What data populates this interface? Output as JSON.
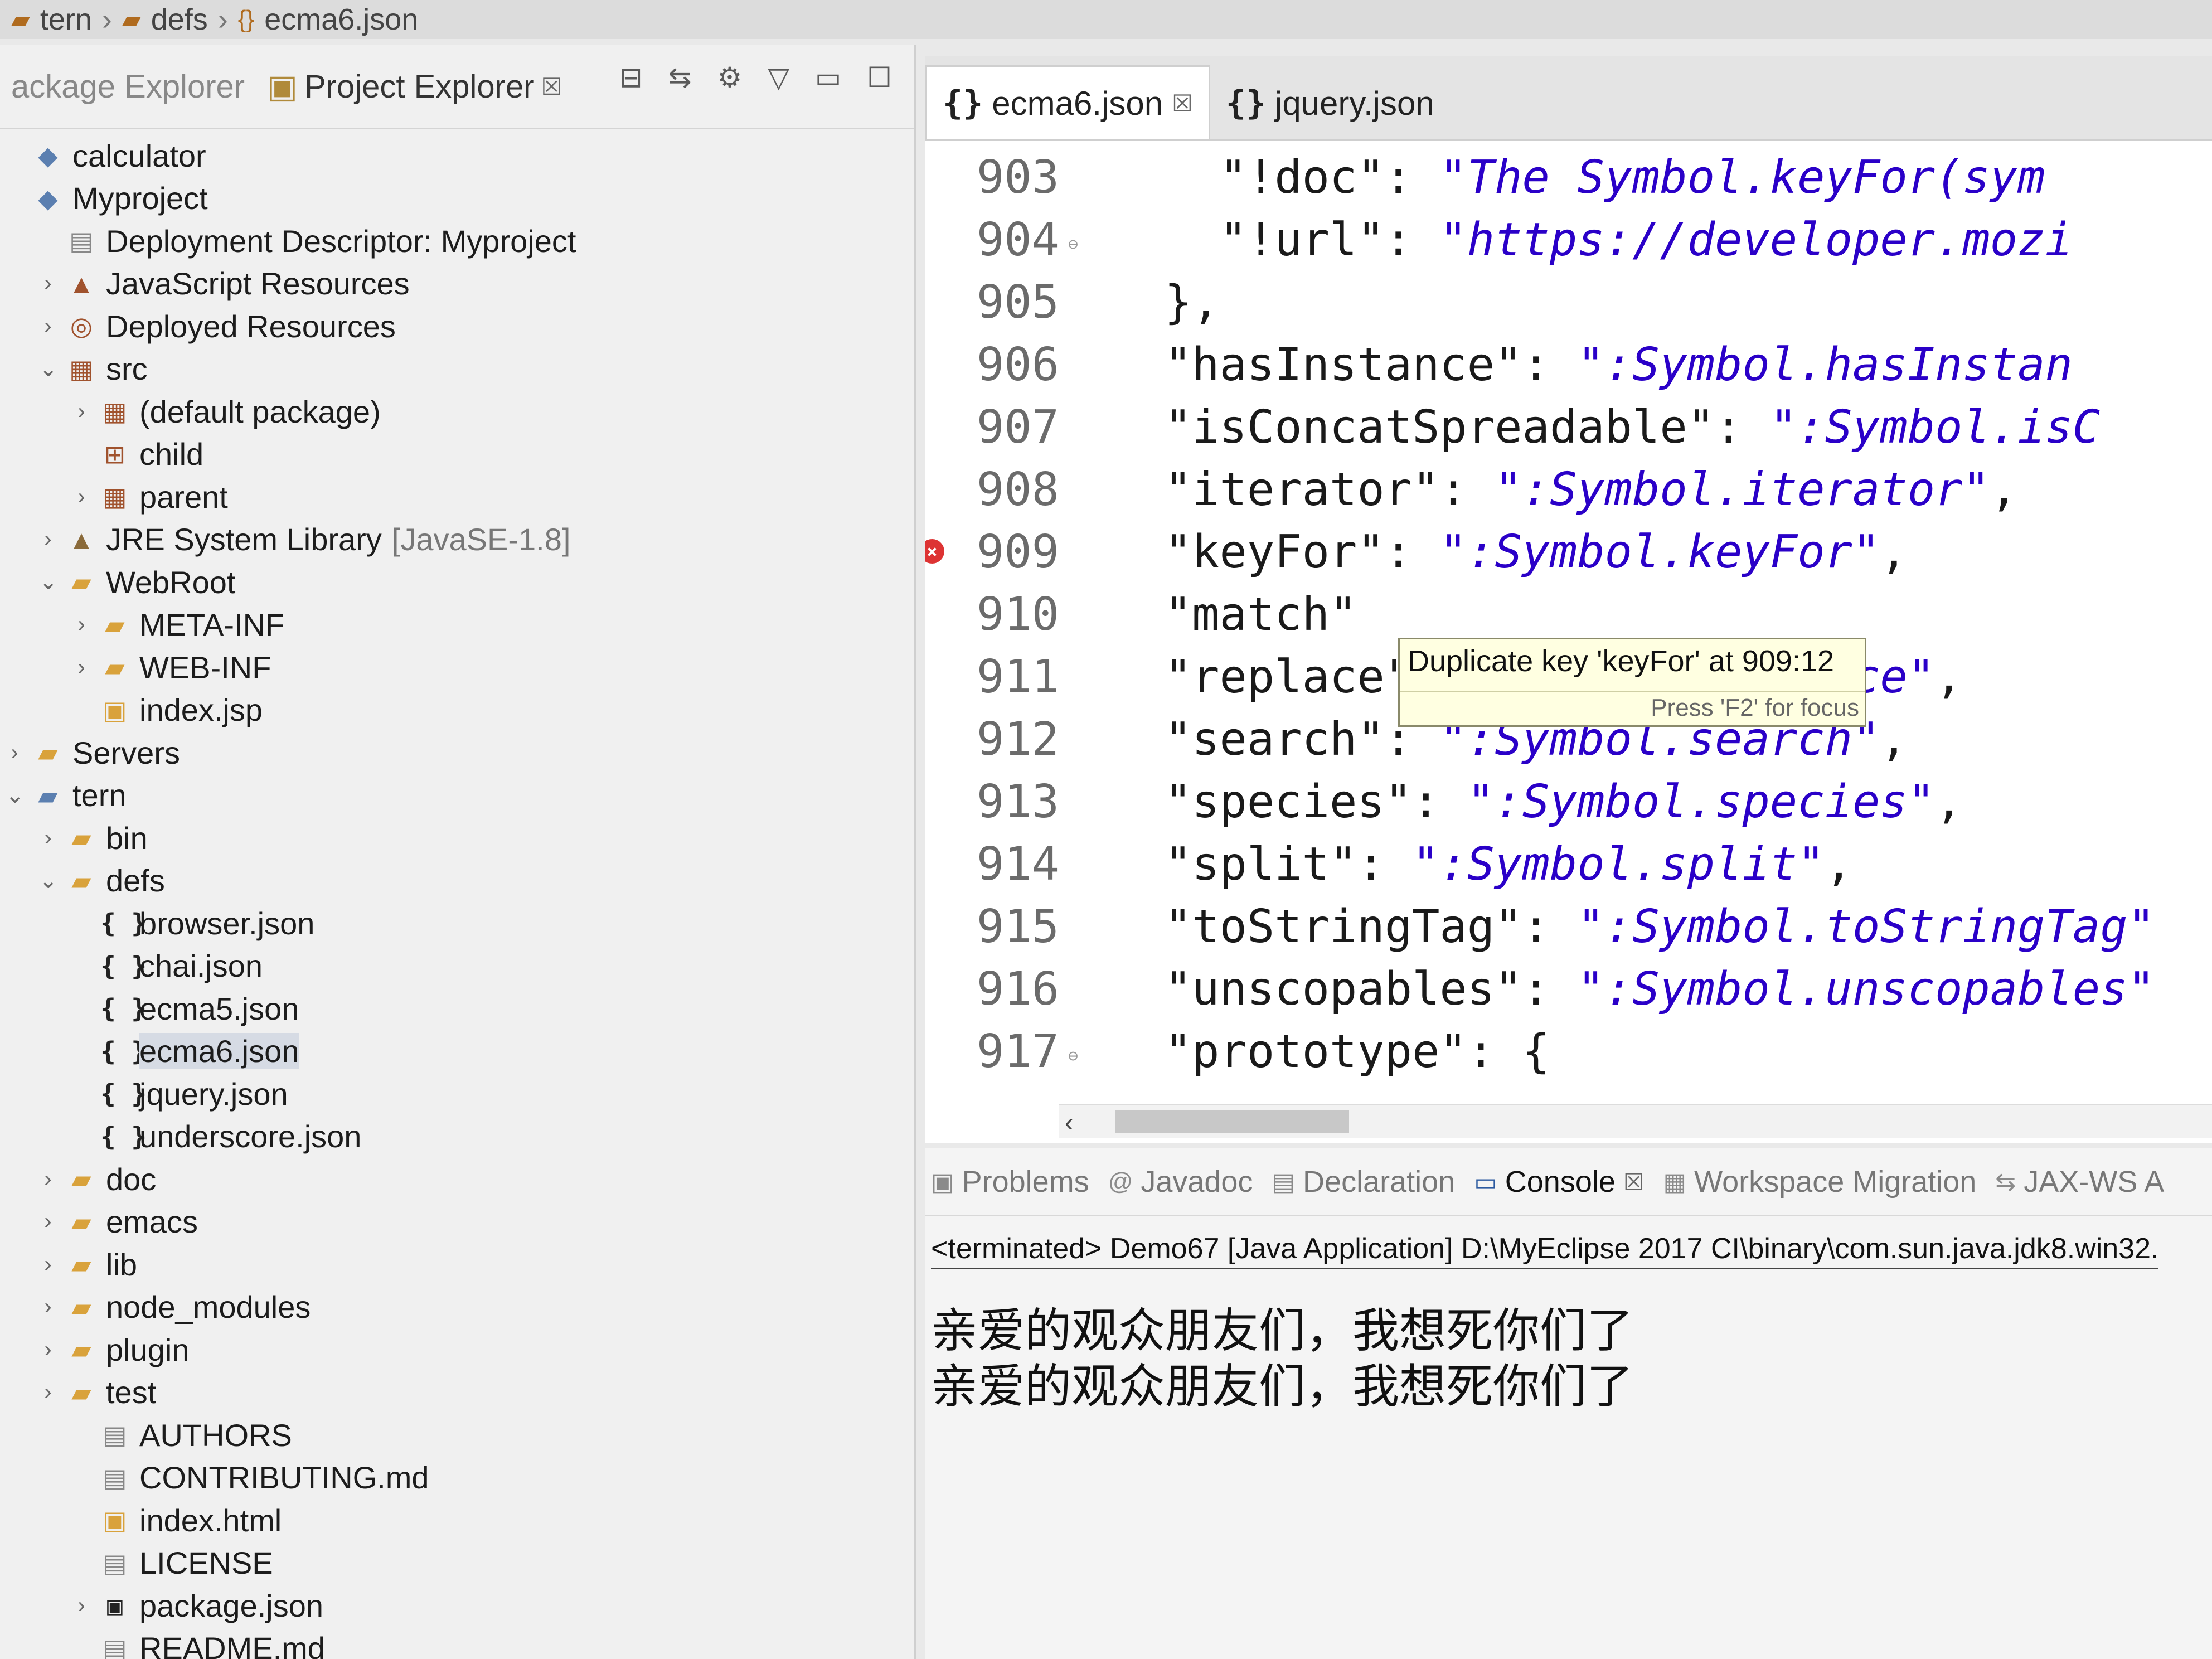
{
  "breadcrumb": {
    "items": [
      "tern",
      "defs",
      "ecma6.json"
    ],
    "separator": "›"
  },
  "left_panel": {
    "tabs": [
      {
        "label": "ackage Explorer"
      },
      {
        "label": "Project Explorer",
        "close": "☒"
      }
    ],
    "tree": [
      {
        "label": "calculator",
        "icon": "project-icon",
        "glyph": "◆",
        "level": 0,
        "chevron": ""
      },
      {
        "label": "Myproject",
        "icon": "project-icon",
        "glyph": "◆",
        "level": 0,
        "chevron": ""
      },
      {
        "label": "Deployment Descriptor: Myproject",
        "icon": "descriptor-icon",
        "glyph": "▤",
        "level": 1,
        "chevron": ""
      },
      {
        "label": "JavaScript Resources",
        "icon": "js-resources-icon",
        "glyph": "▲",
        "level": 1,
        "chevron": "›"
      },
      {
        "label": "Deployed Resources",
        "icon": "deployed-resources-icon",
        "glyph": "◎",
        "level": 1,
        "chevron": "›"
      },
      {
        "label": "src",
        "icon": "source-folder-icon",
        "glyph": "▦",
        "level": 1,
        "chevron": "⌄"
      },
      {
        "label": "(default package)",
        "icon": "package-icon",
        "glyph": "▦",
        "level": 2,
        "chevron": "›"
      },
      {
        "label": "child",
        "icon": "package-icon",
        "glyph": "⊞",
        "level": 2,
        "chevron": ""
      },
      {
        "label": "parent",
        "icon": "package-icon",
        "glyph": "▦",
        "level": 2,
        "chevron": "›"
      },
      {
        "label": "JRE System Library",
        "suffix": "[JavaSE-1.8]",
        "icon": "library-icon",
        "glyph": "▲",
        "level": 1,
        "chevron": "›"
      },
      {
        "label": "WebRoot",
        "icon": "folder-icon",
        "glyph": "▰",
        "level": 1,
        "chevron": "⌄"
      },
      {
        "label": "META-INF",
        "icon": "folder-icon",
        "glyph": "▰",
        "level": 2,
        "chevron": "›"
      },
      {
        "label": "WEB-INF",
        "icon": "folder-icon",
        "glyph": "▰",
        "level": 2,
        "chevron": "›"
      },
      {
        "label": "index.jsp",
        "icon": "jsp-file-icon",
        "glyph": "▣",
        "level": 2,
        "chevron": ""
      },
      {
        "label": "Servers",
        "icon": "folder-icon",
        "glyph": "▰",
        "level": 0,
        "chevron": "›"
      },
      {
        "label": "tern",
        "icon": "project-folder-icon",
        "glyph": "▰",
        "level": 0,
        "chevron": "⌄"
      },
      {
        "label": "bin",
        "icon": "folder-icon",
        "glyph": "▰",
        "level": 1,
        "chevron": "›"
      },
      {
        "label": "defs",
        "icon": "folder-icon",
        "glyph": "▰",
        "level": 1,
        "chevron": "⌄"
      },
      {
        "label": "browser.json",
        "icon": "json-file-icon",
        "glyph": "{ }",
        "level": 2,
        "chevron": ""
      },
      {
        "label": "chai.json",
        "icon": "json-file-icon",
        "glyph": "{ }",
        "level": 2,
        "chevron": ""
      },
      {
        "label": "ecma5.json",
        "icon": "json-file-icon",
        "glyph": "{ }",
        "level": 2,
        "chevron": ""
      },
      {
        "label": "ecma6.json",
        "icon": "json-file-icon",
        "glyph": "{ }",
        "level": 2,
        "chevron": "",
        "selected": true
      },
      {
        "label": "jquery.json",
        "icon": "json-file-icon",
        "glyph": "{ }",
        "level": 2,
        "chevron": ""
      },
      {
        "label": "underscore.json",
        "icon": "json-file-icon",
        "glyph": "{ }",
        "level": 2,
        "chevron": ""
      },
      {
        "label": "doc",
        "icon": "folder-icon",
        "glyph": "▰",
        "level": 1,
        "chevron": "›"
      },
      {
        "label": "emacs",
        "icon": "folder-icon",
        "glyph": "▰",
        "level": 1,
        "chevron": "›"
      },
      {
        "label": "lib",
        "icon": "folder-icon",
        "glyph": "▰",
        "level": 1,
        "chevron": "›"
      },
      {
        "label": "node_modules",
        "icon": "folder-icon",
        "glyph": "▰",
        "level": 1,
        "chevron": "›"
      },
      {
        "label": "plugin",
        "icon": "folder-icon",
        "glyph": "▰",
        "level": 1,
        "chevron": "›"
      },
      {
        "label": "test",
        "icon": "folder-icon",
        "glyph": "▰",
        "level": 1,
        "chevron": "›"
      },
      {
        "label": "AUTHORS",
        "icon": "text-file-icon",
        "glyph": "▤",
        "level": 2,
        "chevron": ""
      },
      {
        "label": "CONTRIBUTING.md",
        "icon": "text-file-icon",
        "glyph": "▤",
        "level": 2,
        "chevron": ""
      },
      {
        "label": "index.html",
        "icon": "html-file-icon",
        "glyph": "▣",
        "level": 2,
        "chevron": ""
      },
      {
        "label": "LICENSE",
        "icon": "text-file-icon",
        "glyph": "▤",
        "level": 2,
        "chevron": ""
      },
      {
        "label": "package.json",
        "icon": "json-file-icon",
        "glyph": "▣",
        "level": 2,
        "chevron": "›"
      },
      {
        "label": "README.md",
        "icon": "text-file-icon",
        "glyph": "▤",
        "level": 2,
        "chevron": ""
      }
    ]
  },
  "editor": {
    "tabs": [
      {
        "label": "ecma6.json",
        "close": "☒",
        "active": true
      },
      {
        "label": "jquery.json",
        "active": false
      }
    ],
    "lines": [
      {
        "num": "903",
        "indent": "    ",
        "key": "\"!doc\": ",
        "value": "\"The Symbol.keyFor(sym",
        "tail": ""
      },
      {
        "num": "904",
        "fold": true,
        "indent": "    ",
        "key": "\"!url\": ",
        "value": "\"https://developer.mozi",
        "tail": ""
      },
      {
        "num": "905",
        "indent": "  ",
        "key": "},",
        "value": "",
        "tail": ""
      },
      {
        "num": "906",
        "indent": "  ",
        "key": "\"hasInstance\": ",
        "value": "\":Symbol.hasInstan",
        "tail": ""
      },
      {
        "num": "907",
        "indent": "  ",
        "key": "\"isConcatSpreadable\": ",
        "value": "\":Symbol.isC",
        "tail": ""
      },
      {
        "num": "908",
        "indent": "  ",
        "key": "\"iterator\": ",
        "value": "\":Symbol.iterator\"",
        "tail": ","
      },
      {
        "num": "909",
        "error": true,
        "indent": "  ",
        "key": "\"keyFor\": ",
        "value": "\":Symbol.keyFor\"",
        "tail": ","
      },
      {
        "num": "910",
        "indent": "  ",
        "key": "\"match\"",
        "value": "",
        "tail": ""
      },
      {
        "num": "911",
        "indent": "  ",
        "key": "\"replace\": ",
        "value": "\":Symbol.replace\"",
        "tail": ","
      },
      {
        "num": "912",
        "indent": "  ",
        "key": "\"search\": ",
        "value": "\":Symbol.search\"",
        "tail": ","
      },
      {
        "num": "913",
        "indent": "  ",
        "key": "\"species\": ",
        "value": "\":Symbol.species\"",
        "tail": ","
      },
      {
        "num": "914",
        "indent": "  ",
        "key": "\"split\": ",
        "value": "\":Symbol.split\"",
        "tail": ","
      },
      {
        "num": "915",
        "indent": "  ",
        "key": "\"toStringTag\": ",
        "value": "\":Symbol.toStringTag\"",
        "tail": ""
      },
      {
        "num": "916",
        "indent": "  ",
        "key": "\"unscopables\": ",
        "value": "\":Symbol.unscopables\"",
        "tail": ""
      },
      {
        "num": "917",
        "fold": true,
        "indent": "  ",
        "key": "\"prototype\": {",
        "value": "",
        "tail": ""
      }
    ],
    "tooltip": {
      "message": "Duplicate key 'keyFor' at 909:12",
      "hint": "Press 'F2' for focus"
    },
    "scroll_arrow": "‹"
  },
  "bottom_panel": {
    "tabs": [
      {
        "label": "Problems",
        "icon": "problems-icon",
        "glyph": "▣"
      },
      {
        "label": "Javadoc",
        "icon": "javadoc-icon",
        "glyph": "@"
      },
      {
        "label": "Declaration",
        "icon": "declaration-icon",
        "glyph": "▤"
      },
      {
        "label": "Console",
        "icon": "console-icon",
        "glyph": "▭",
        "active": true,
        "close": "☒"
      },
      {
        "label": "Workspace Migration",
        "icon": "migration-icon",
        "glyph": "▦"
      },
      {
        "label": "JAX-WS A",
        "icon": "jaxws-icon",
        "glyph": "⇆"
      }
    ],
    "console": {
      "header": "<terminated> Demo67 [Java Application] D:\\MyEclipse 2017 CI\\binary\\com.sun.java.jdk8.win32.",
      "lines": [
        "亲爱的观众朋友们，我想死你们了",
        "亲爱的观众朋友们，我想死你们了"
      ]
    }
  },
  "colors": {
    "string": "#2a00c8",
    "tooltip_bg": "#ffffe1",
    "error": "#dd3333",
    "selection": "#d6dbe4"
  }
}
